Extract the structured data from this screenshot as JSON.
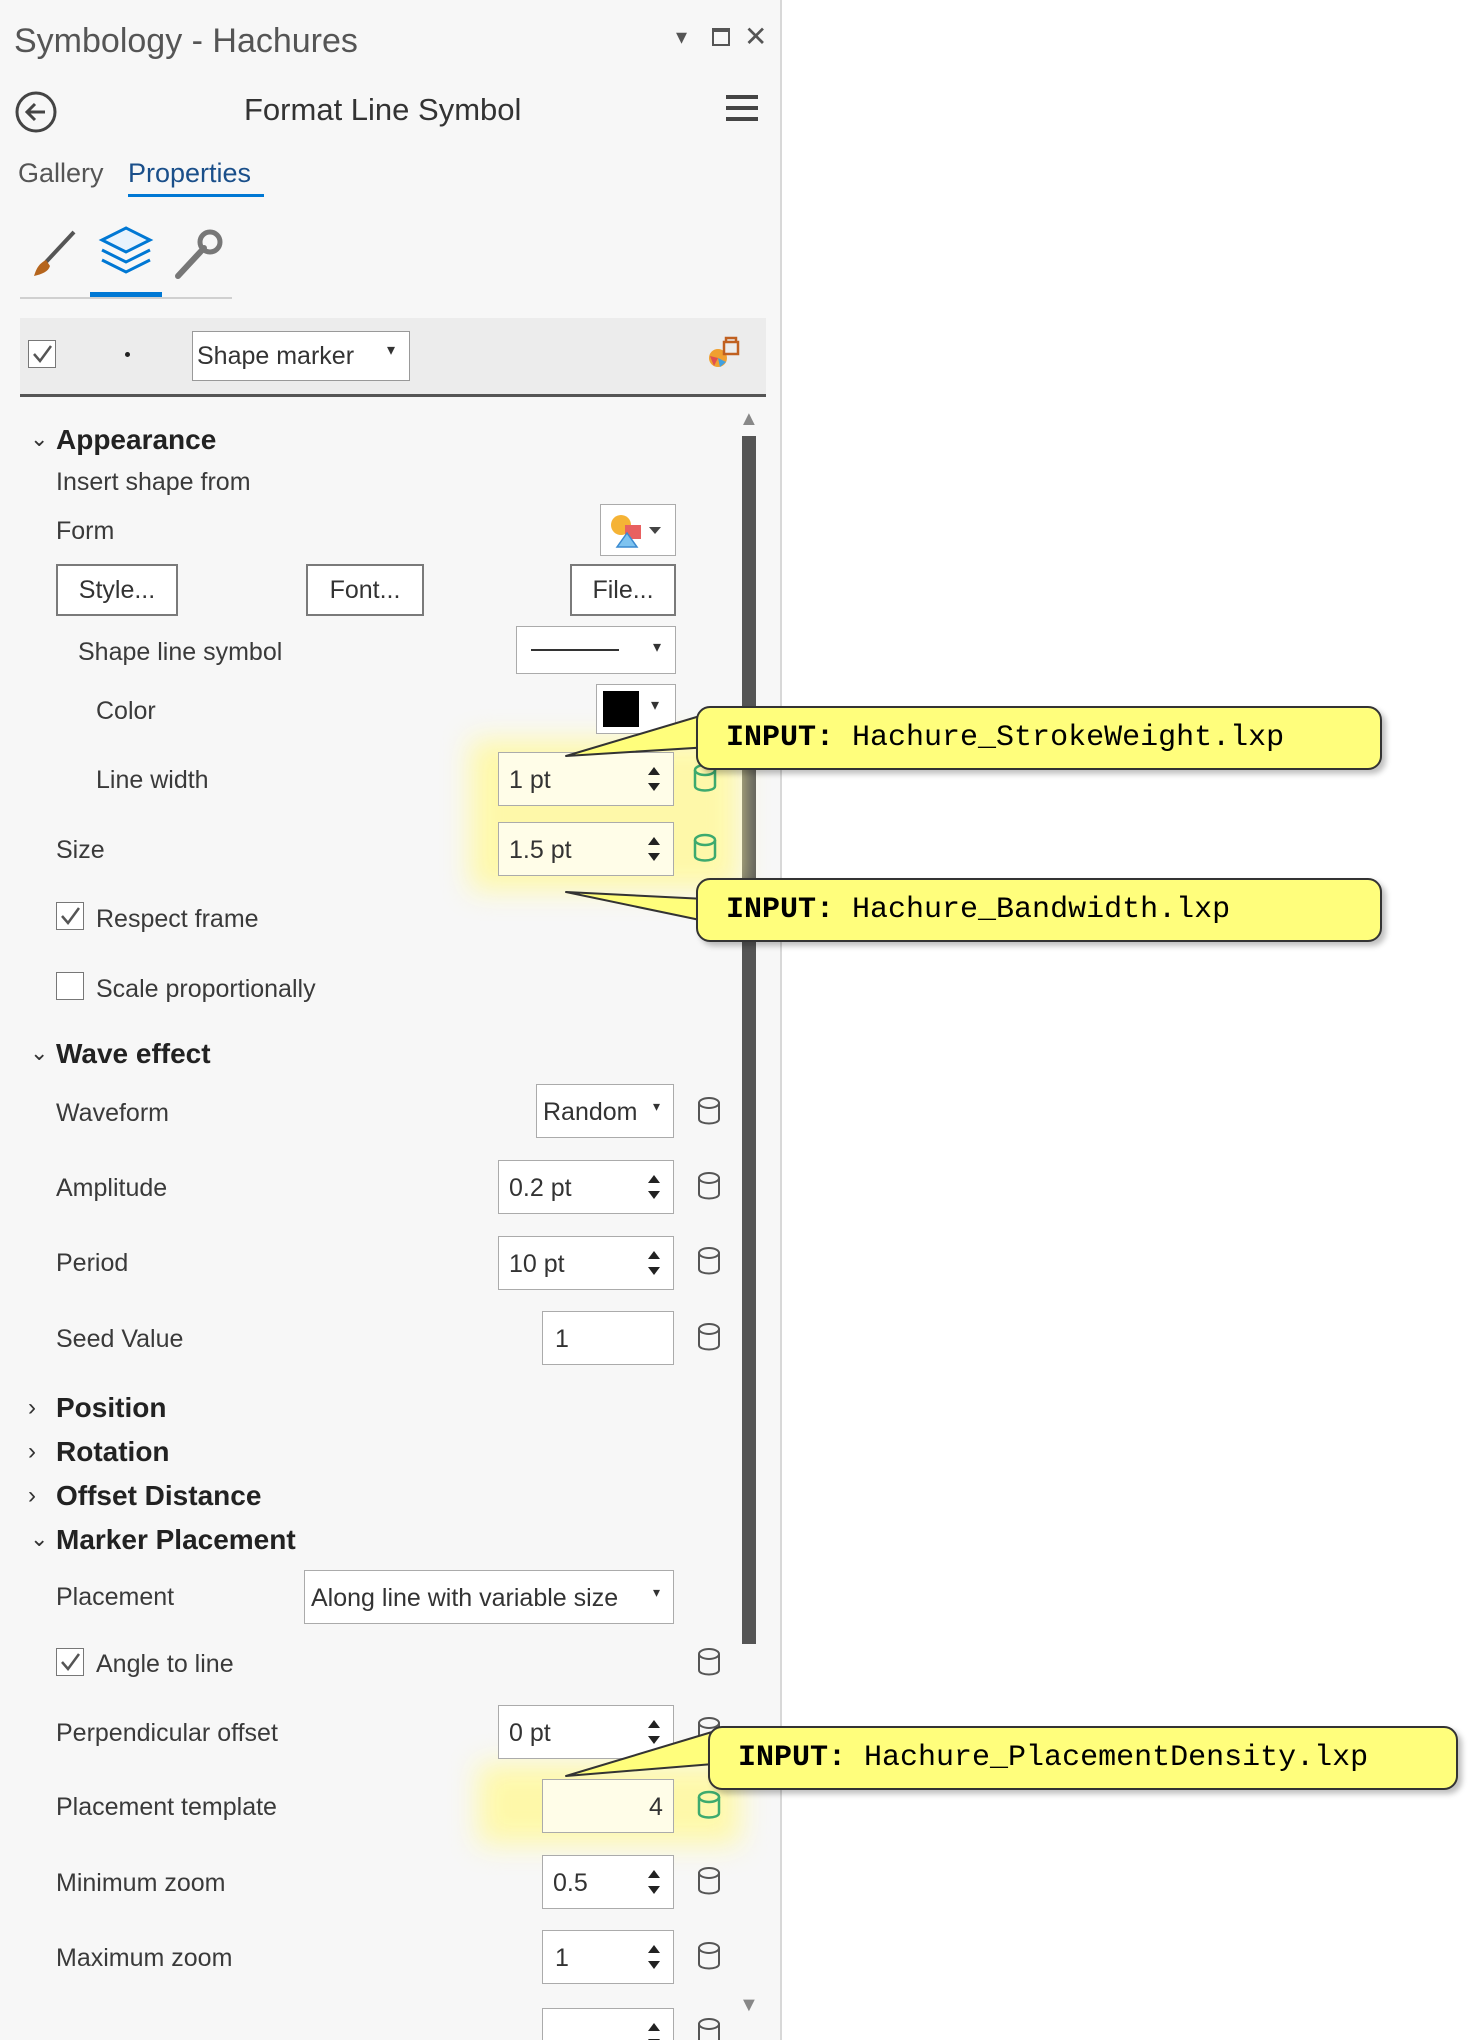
{
  "window": {
    "title": "Symbology - Hachures",
    "controls": [
      "▾",
      "☐",
      "✕"
    ]
  },
  "header": {
    "title": "Format Line Symbol"
  },
  "tabs": [
    {
      "label": "Gallery"
    },
    {
      "label": "Properties"
    }
  ],
  "layer_row": {
    "marker_type": "Shape marker"
  },
  "appearance": {
    "section_label": "Appearance",
    "insert_shape_from": "Insert shape from",
    "form_label": "Form",
    "buttons": {
      "style": "Style...",
      "font": "Font...",
      "file": "File..."
    },
    "shape_line_symbol_label": "Shape line symbol",
    "color_label": "Color",
    "color_value": "#000000",
    "line_width_label": "Line width",
    "line_width_value": "1 pt",
    "size_label": "Size",
    "size_value": "1.5 pt",
    "respect_frame_label": "Respect frame",
    "respect_frame_checked": true,
    "scale_proportionally_label": "Scale proportionally",
    "scale_proportionally_checked": false
  },
  "wave_effect": {
    "section_label": "Wave effect",
    "waveform_label": "Waveform",
    "waveform_value": "Random",
    "amplitude_label": "Amplitude",
    "amplitude_value": "0.2 pt",
    "period_label": "Period",
    "period_value": "10 pt",
    "seed_label": "Seed Value",
    "seed_value": "1"
  },
  "collapsed_sections": {
    "position": "Position",
    "rotation": "Rotation",
    "offset_distance": "Offset Distance"
  },
  "marker_placement": {
    "section_label": "Marker Placement",
    "placement_label": "Placement",
    "placement_value": "Along line with variable size",
    "angle_to_line_label": "Angle to line",
    "angle_to_line_checked": true,
    "perp_offset_label": "Perpendicular offset",
    "perp_offset_value": "0 pt",
    "template_label": "Placement template",
    "template_value": "4",
    "min_zoom_label": "Minimum zoom",
    "min_zoom_value": "0.5",
    "max_zoom_label": "Maximum zoom",
    "max_zoom_value": "1"
  },
  "callouts": {
    "prefix": "INPUT:",
    "stroke_weight": "Hachure_StrokeWeight.lxp",
    "bandwidth": "Hachure_Bandwidth.lxp",
    "placement_density": "Hachure_PlacementDensity.lxp"
  },
  "colors": {
    "accent": "#0078d4",
    "highlight": "#fff9a5",
    "callout": "#fffe7c",
    "db_icon": "#3daa6e"
  }
}
